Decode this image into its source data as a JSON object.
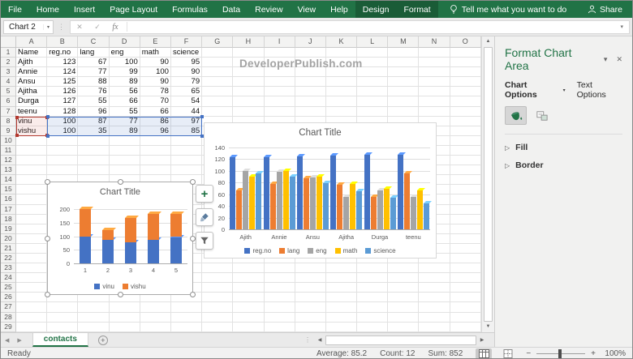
{
  "ribbon": {
    "tabs": [
      {
        "label": "File",
        "contextual": false
      },
      {
        "label": "Home",
        "contextual": false
      },
      {
        "label": "Insert",
        "contextual": false
      },
      {
        "label": "Page Layout",
        "contextual": false
      },
      {
        "label": "Formulas",
        "contextual": false
      },
      {
        "label": "Data",
        "contextual": false
      },
      {
        "label": "Review",
        "contextual": false
      },
      {
        "label": "View",
        "contextual": false
      },
      {
        "label": "Help",
        "contextual": false
      },
      {
        "label": "Design",
        "contextual": true
      },
      {
        "label": "Format",
        "contextual": true
      }
    ],
    "tell_me": "Tell me what you want to do",
    "share": "Share"
  },
  "formula_bar": {
    "name_box": "Chart 2",
    "cancel": "✕",
    "enter": "✓",
    "fx": "fx"
  },
  "sheet": {
    "columns": [
      "A",
      "B",
      "C",
      "D",
      "E",
      "F",
      "G",
      "H",
      "I",
      "J",
      "K",
      "L",
      "M",
      "N",
      "O"
    ],
    "visible_rows": 29,
    "cells": [
      [
        "Name",
        "reg.no",
        "lang",
        "eng",
        "math",
        "science"
      ],
      [
        "Ajith",
        "123",
        "67",
        "100",
        "90",
        "95"
      ],
      [
        "Annie",
        "124",
        "77",
        "99",
        "100",
        "90"
      ],
      [
        "Ansu",
        "125",
        "88",
        "89",
        "90",
        "79"
      ],
      [
        "Ajitha",
        "126",
        "76",
        "56",
        "78",
        "65"
      ],
      [
        "Durga",
        "127",
        "55",
        "66",
        "70",
        "54"
      ],
      [
        "teenu",
        "128",
        "96",
        "55",
        "66",
        "44"
      ],
      [
        "vinu",
        "100",
        "87",
        "77",
        "86",
        "97"
      ],
      [
        "vishu",
        "100",
        "35",
        "89",
        "96",
        "85"
      ]
    ],
    "watermark": "DeveloperPublish.com",
    "selection": {
      "category_range": "A8:A9",
      "value_range": "B8:F9"
    }
  },
  "chart_buttons": {
    "elements_glyph": "+",
    "icons": [
      "plus-icon",
      "brush-icon",
      "funnel-icon"
    ]
  },
  "panel": {
    "title": "Format Chart Area",
    "tabs": [
      "Chart Options",
      "Text Options"
    ],
    "icon_names": [
      "paint-bucket-icon",
      "effects-pentagon-icon",
      "size-properties-icon"
    ],
    "sections": [
      "Fill",
      "Border"
    ]
  },
  "sheet_tabs": {
    "active": "contacts"
  },
  "statusbar": {
    "mode": "Ready",
    "average": "Average: 85.2",
    "count": "Count: 12",
    "sum": "Sum: 852",
    "zoom_level": "100%"
  },
  "glyphs": {
    "dropdown": "▾",
    "close": "✕",
    "up": "▲",
    "down": "▼",
    "left": "◀",
    "right": "▶",
    "minus": "−",
    "plus": "+",
    "section_collapsed": "▷",
    "dots": "⋮",
    "new_sheet": "+"
  },
  "colors": {
    "excel_green": "#217346",
    "contextual_tab_green": "#1a5c37",
    "selection_blue": "#4472c4",
    "selection_red": "#b2392f",
    "chart_text": "#595959"
  },
  "chart_data": [
    {
      "type": "bar",
      "subtype": "stacked-column-3d",
      "title": "Chart Title",
      "categories": [
        "1",
        "2",
        "3",
        "4",
        "5"
      ],
      "series": [
        {
          "name": "vinu",
          "color": "#4472c4",
          "values": [
            100,
            87,
            77,
            86,
            97
          ]
        },
        {
          "name": "vishu",
          "color": "#ed7d31",
          "values": [
            100,
            35,
            89,
            96,
            85
          ]
        }
      ],
      "ylim": [
        0,
        200
      ],
      "ytick": 50,
      "grid": true,
      "legend_position": "bottom"
    },
    {
      "type": "bar",
      "subtype": "clustered-column-3d",
      "title": "Chart Title",
      "categories": [
        "Ajith",
        "Annie",
        "Ansu",
        "Ajitha",
        "Durga",
        "teenu"
      ],
      "series": [
        {
          "name": "reg.no",
          "color": "#4472c4",
          "values": [
            123,
            124,
            125,
            126,
            127,
            128
          ]
        },
        {
          "name": "lang",
          "color": "#ed7d31",
          "values": [
            67,
            77,
            88,
            76,
            55,
            96
          ]
        },
        {
          "name": "eng",
          "color": "#a5a5a5",
          "values": [
            100,
            99,
            89,
            56,
            66,
            55
          ]
        },
        {
          "name": "math",
          "color": "#ffc000",
          "values": [
            90,
            100,
            90,
            78,
            70,
            66
          ]
        },
        {
          "name": "science",
          "color": "#5b9bd5",
          "values": [
            95,
            90,
            79,
            65,
            54,
            44
          ]
        }
      ],
      "ylim": [
        0,
        140
      ],
      "ytick": 20,
      "grid": true,
      "legend_position": "bottom"
    }
  ]
}
